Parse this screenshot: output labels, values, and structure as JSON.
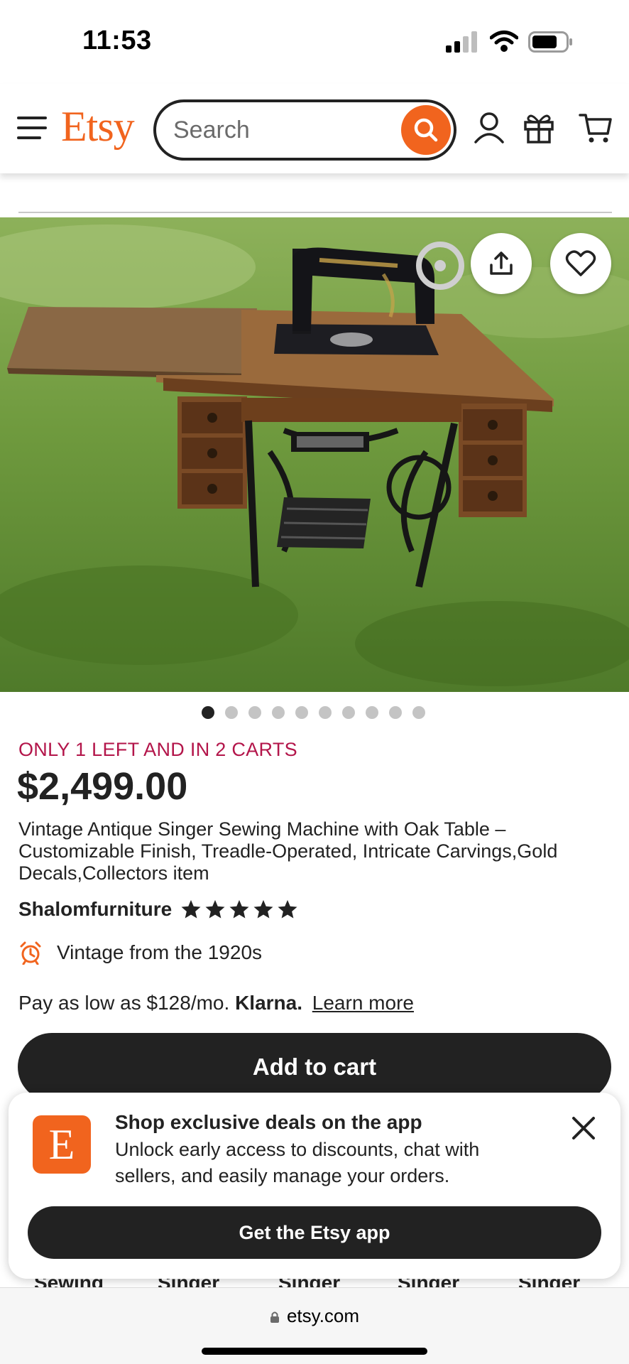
{
  "status_bar": {
    "time": "11:53"
  },
  "header": {
    "logo": "Etsy",
    "search": {
      "placeholder": "Search",
      "value": ""
    },
    "icons": [
      "menu-icon",
      "search-icon",
      "account-icon",
      "gift-icon",
      "cart-icon"
    ]
  },
  "gallery": {
    "image": "Antique Singer treadle sewing machine on a carved oak table standing on grass",
    "dot_count": 10,
    "active_dot": 0,
    "icons": [
      "share-icon",
      "heart-icon"
    ]
  },
  "listing": {
    "stock_notice": "ONLY 1 LEFT AND IN 2 CARTS",
    "price": "$2,499.00",
    "title": "Vintage Antique Singer Sewing Machine with Oak Table – Customizable Finish, Treadle-Operated, Intricate Carvings,Gold Decals,Collectors item",
    "shop_name": "Shalomfurniture",
    "rating_stars": 5,
    "vintage_text": "Vintage from the 1920s",
    "klarna": {
      "prefix": "Pay as low as $128/mo.",
      "brand": "Klarna.",
      "link": "Learn more"
    },
    "add_to_cart": "Add to cart"
  },
  "peek_items": [
    "Sewing",
    "Singer",
    "Singer",
    "Singer",
    "Singer"
  ],
  "app_banner": {
    "logo_letter": "E",
    "title": "Shop exclusive deals on the app",
    "body": "Unlock early access to discounts, chat with sellers, and easily manage your orders.",
    "button": "Get the Etsy app"
  },
  "browser": {
    "url": "etsy.com"
  },
  "colors": {
    "brand_orange": "#f1641e",
    "stock_red": "#b3154a",
    "dark": "#222222"
  }
}
